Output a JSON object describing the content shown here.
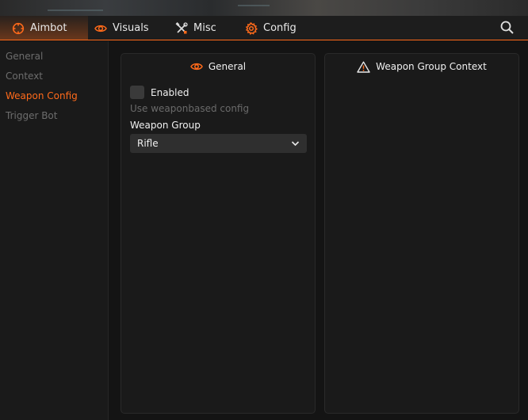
{
  "tabs": [
    {
      "label": "Aimbot",
      "icon": "crosshair-icon",
      "active": true
    },
    {
      "label": "Visuals",
      "icon": "eye-icon",
      "active": false
    },
    {
      "label": "Misc",
      "icon": "tools-icon",
      "active": false
    },
    {
      "label": "Config",
      "icon": "gear-icon",
      "active": false
    }
  ],
  "sidebar": {
    "items": [
      {
        "label": "General",
        "active": false
      },
      {
        "label": "Context",
        "active": false
      },
      {
        "label": "Weapon Config",
        "active": true
      },
      {
        "label": "Trigger Bot",
        "active": false
      }
    ]
  },
  "panels": {
    "general": {
      "title": "General",
      "enabled_label": "Enabled",
      "hint": "Use weaponbased config",
      "weapon_group_label": "Weapon Group",
      "weapon_group_value": "Rifle"
    },
    "context": {
      "title": "Weapon Group Context"
    }
  },
  "colors": {
    "accent": "#ff6a1a",
    "background": "#141414",
    "panel": "#1a1a1a",
    "muted_text": "#6d6d6d"
  }
}
